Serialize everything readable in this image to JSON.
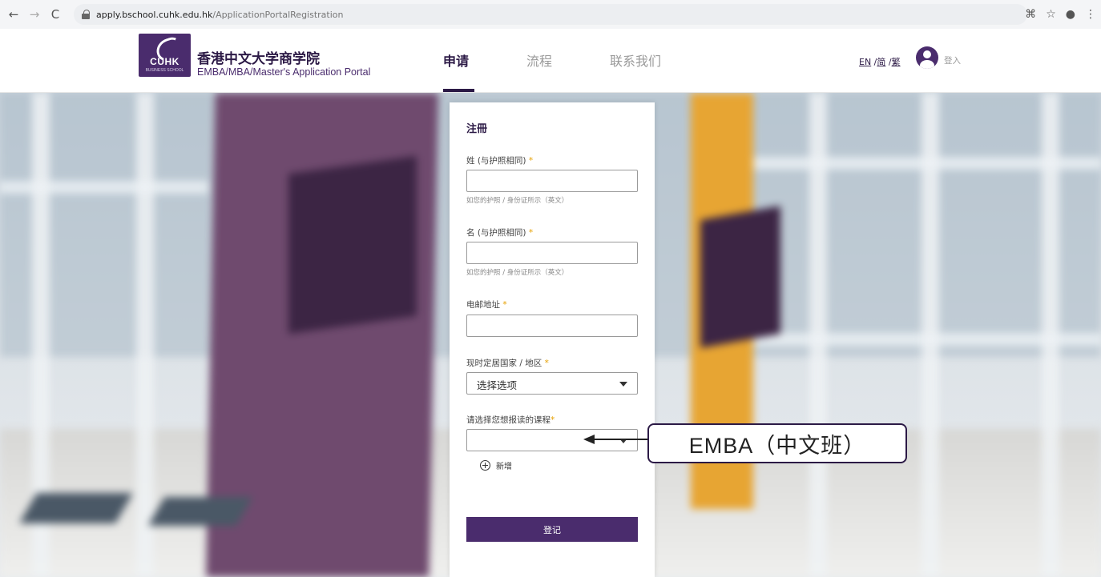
{
  "browser": {
    "url_host": "apply.bschool.cuhk.edu.hk",
    "url_path": "/ApplicationPortalRegistration"
  },
  "logo": {
    "text": "CUHK",
    "subtext": "BUSINESS SCHOOL"
  },
  "header": {
    "title": "香港中文大学商学院",
    "subtitle": "EMBA/MBA/Master's Application Portal",
    "nav": [
      "申请",
      "流程",
      "联系我们"
    ],
    "active_nav": "申请",
    "lang_en": "EN",
    "lang_sep1": " /",
    "lang_sc": "简",
    "lang_sep2": " /",
    "lang_tc": "繁",
    "login": "登入"
  },
  "form": {
    "title": "注冊",
    "last_name_label": "姓 (与护照相同)",
    "last_name_hint": "如您的护照 / 身份证所示（英文）",
    "first_name_label": "名 (与护照相同)",
    "first_name_hint": "如您的护照 / 身份证所示（英文）",
    "email_label": "电邮地址",
    "country_label": "现时定居国家 / 地区",
    "country_value": "选择选项",
    "program_label": "请选择您想报读的课程",
    "program_value": "",
    "required_mark": "*",
    "add_label": "新增",
    "submit_label": "登记"
  },
  "callout": {
    "text": "EMBA（中文班）"
  },
  "colors": {
    "brand_purple": "#4a2c6d",
    "required_orange": "#e6a000"
  }
}
